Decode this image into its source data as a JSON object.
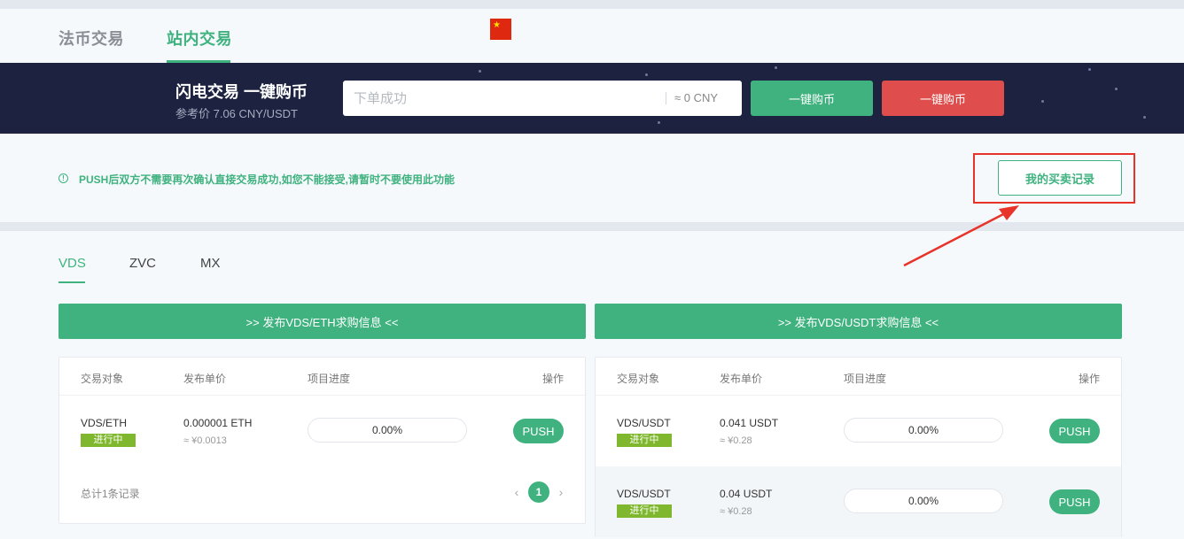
{
  "top_nav": {
    "tabs": [
      {
        "label": "法币交易",
        "active": false
      },
      {
        "label": "站内交易",
        "active": true
      }
    ],
    "flag_icon": "china-flag-icon"
  },
  "flash_trade": {
    "title": "闪电交易 一键购币",
    "reference": "参考价 7.06 CNY/USDT",
    "input_placeholder": "下单成功",
    "approx_value": "≈ 0 CNY",
    "buy_label": "一键购币",
    "sell_label": "一键购币"
  },
  "notice": {
    "message": "PUSH后双方不需要再次确认直接交易成功,如您不能接受,请暂时不要使用此功能",
    "records_button": "我的买卖记录"
  },
  "coin_tabs": [
    {
      "label": "VDS",
      "active": true
    },
    {
      "label": "ZVC",
      "active": false
    },
    {
      "label": "MX",
      "active": false
    }
  ],
  "left_panel": {
    "publish_label": ">>  发布VDS/ETH求购信息  <<",
    "columns": [
      "交易对象",
      "发布单价",
      "项目进度",
      "操作"
    ],
    "rows": [
      {
        "pair": "VDS/ETH",
        "status": "进行中",
        "price": "0.000001 ETH",
        "approx": "≈ ¥0.0013",
        "progress": "0.00%",
        "action": "PUSH"
      }
    ],
    "total": "总计1条记录",
    "page": "1"
  },
  "right_panel": {
    "publish_label": ">>  发布VDS/USDT求购信息  <<",
    "columns": [
      "交易对象",
      "发布单价",
      "项目进度",
      "操作"
    ],
    "rows": [
      {
        "pair": "VDS/USDT",
        "status": "进行中",
        "price": "0.041 USDT",
        "approx": "≈ ¥0.28",
        "progress": "0.00%",
        "action": "PUSH"
      },
      {
        "pair": "VDS/USDT",
        "status": "进行中",
        "price": "0.04 USDT",
        "approx": "≈ ¥0.28",
        "progress": "0.00%",
        "action": "PUSH"
      }
    ]
  },
  "colors": {
    "accent": "#3fb27f",
    "sell": "#e04d4d",
    "banner": "#1c2240",
    "status_badge": "#7fb82e",
    "highlight": "#e8332a"
  }
}
